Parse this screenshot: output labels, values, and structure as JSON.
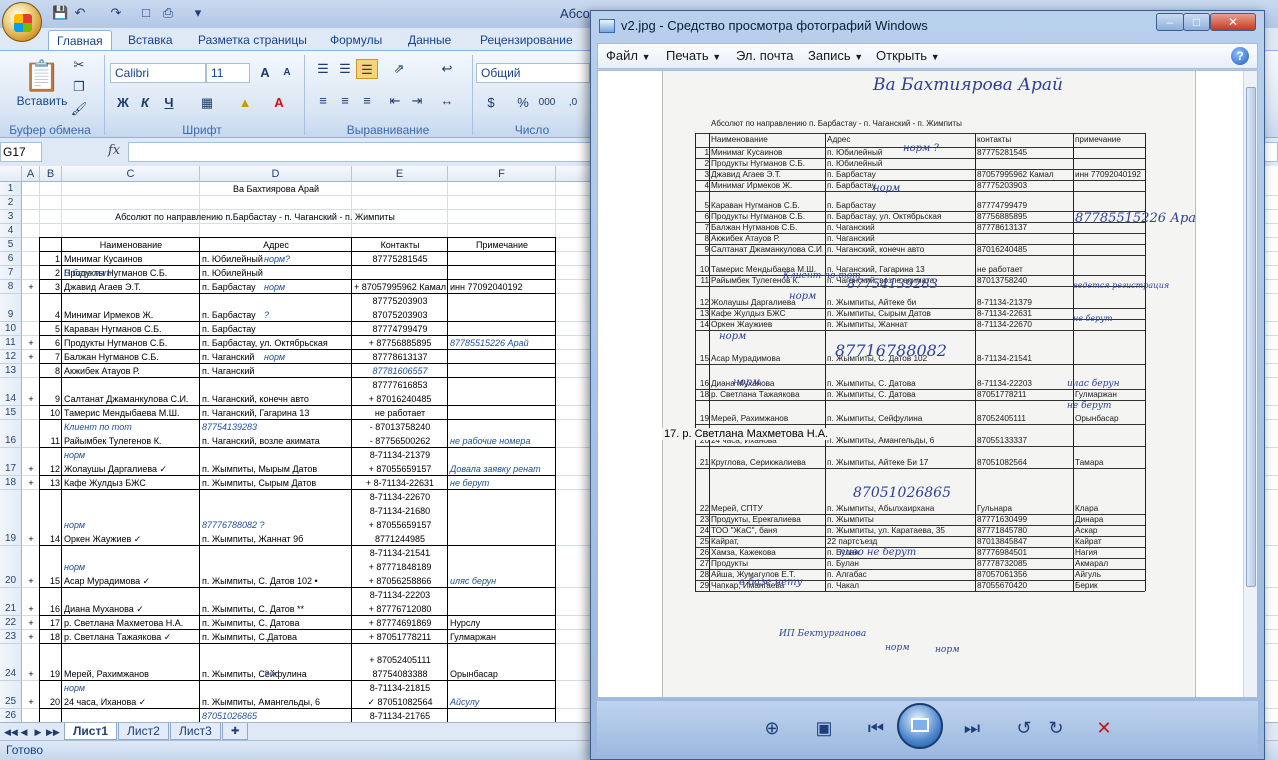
{
  "excel": {
    "title": "Абсолют по направлению...",
    "tabs": [
      "Главная",
      "Вставка",
      "Разметка страницы",
      "Формулы",
      "Данные",
      "Рецензирование"
    ],
    "ribbon": {
      "paste_label": "Вставить",
      "font_name": "Calibri",
      "font_size": "11",
      "number_format": "Общий",
      "groups": [
        "Буфер обмена",
        "Шрифт",
        "Выравнивание",
        "Число"
      ],
      "bold": "Ж",
      "italic": "К",
      "underline": "Ч"
    },
    "name_box": "G17",
    "fx": "fx",
    "columns": [
      "A",
      "B",
      "C",
      "D",
      "E",
      "F",
      "G"
    ],
    "title_row": "Ва     Бахтиярова Арай",
    "route_title": "Абсолют по направлению п.Барбастау - п. Чаганский - п. Жимпиты",
    "headers": {
      "name": "Наименование",
      "address": "Адрес",
      "contacts": "Контакты",
      "note": "Примечание"
    },
    "rows": [
      {
        "r": "6",
        "a": "",
        "b": "1",
        "c": "Минимаг Кусаинов",
        "d": "п. Юбилейный",
        "dn": "норм?",
        "e": "87775281545",
        "f": ""
      },
      {
        "r": "7",
        "a": "",
        "b": "2",
        "c": "Продукты Нугманов С.Б.",
        "d": "п. Юбилейный",
        "dn": "",
        "e": "",
        "f": ""
      },
      {
        "r": "8",
        "a": "+",
        "b": "3",
        "c": "Джавид Агаев Э.Т.",
        "cn": "В базе нет",
        "d": "п. Барбастау",
        "dn": "норм",
        "e": "+ 87057995962 Камал",
        "f": "инн 77092040192"
      },
      {
        "r": "9",
        "a": "",
        "b": "4",
        "c": "Минимаг Ирмеков Ж.",
        "d": "п. Барбастау",
        "dn": "?",
        "e": "87775203903\n87075203903",
        "f": ""
      },
      {
        "r": "10",
        "a": "",
        "b": "5",
        "c": "Караван Нугманов С.Б.",
        "d": "п. Барбастау",
        "dn": "",
        "e": "87774799479",
        "f": ""
      },
      {
        "r": "11",
        "a": "+",
        "b": "6",
        "c": "Продукты Нугманов С.Б.",
        "d": "п. Барбастау, ул. Октябрьская",
        "dn": "",
        "e": "+ 87756885895",
        "f": "87785515226 Арай",
        "fnote": true
      },
      {
        "r": "12",
        "a": "+",
        "b": "7",
        "c": "Балжан Нугманов С.Б.",
        "d": "п. Чаганский",
        "dn": "норм",
        "e": "87778613137",
        "f": ""
      },
      {
        "r": "13",
        "a": "",
        "b": "8",
        "c": "Акжибек Атауов Р.",
        "d": "п. Чаганский",
        "dn": "",
        "e": "87781606557",
        "enote": true,
        "f": ""
      },
      {
        "r": "14",
        "a": "+",
        "b": "9",
        "c": "Салтанат Джаманкулова С.И.",
        "d": "п. Чаганский, конечн авто",
        "dn": "",
        "e": "87777616853\n+ 87016240485",
        "f": ""
      },
      {
        "r": "15",
        "a": "",
        "b": "10",
        "c": "Тамерис Мендыбаева М.Ш.",
        "d": "п. Чаганский, Гагарина 13",
        "dn": "",
        "e": "не работает",
        "f": ""
      },
      {
        "r": "16",
        "a": "",
        "b": "11",
        "c": "Райымбек Тулегенов К.",
        "cn": "Клиент по тот",
        "d": "п. Чаганский, возле акимата",
        "dtop": "87754139283",
        "dn": "",
        "e": "- 87013758240\n- 87756500262",
        "f": "не рабочие номера",
        "fnote": true
      },
      {
        "r": "17",
        "a": "+",
        "b": "12",
        "c": "Жолаушы Даргалиева ✓",
        "cn": "норм",
        "d": "п. Жымпиты, Мырым Датов",
        "dn": "",
        "e": "8-71134-21379\n+ 87055659157",
        "f": "Довала заявку  ренат",
        "fnote": true
      },
      {
        "r": "18",
        "a": "+",
        "b": "13",
        "c": "Кафе Жулдыз БЖС",
        "d": "п. Жымпиты, Сырым Датов",
        "dn": "",
        "e": "+ 8-71134-22631",
        "f": "не берут",
        "fnote": true
      },
      {
        "r": "19",
        "a": "+",
        "b": "14",
        "c": "Оркен Жаужиев ✓",
        "cn": "норм",
        "d": "п. Жымпиты, Жаннат 9б",
        "dtop": "87776788082            ?",
        "dn": "",
        "e": "8-71134-22670\n8-71134-21680\n+ 87055659157\n8771244985",
        "f": ""
      },
      {
        "r": "20",
        "a": "+",
        "b": "15",
        "c": "Асар Мурадимова ✓",
        "cn": "норм",
        "d": "п. Жымпиты, С. Датов 102 •",
        "dn": "",
        "e": "8-71134-21541\n+ 87771848189\n+ 87056258866",
        "f": "иляс берун",
        "fnote": true
      },
      {
        "r": "21",
        "a": "+",
        "b": "16",
        "c": "Диана Муханова ✓",
        "d": "п. Жымпиты, С. Датов **",
        "dn": "",
        "e": "8-71134-22203\n+ 87776712080",
        "f": ""
      },
      {
        "r": "22",
        "a": "+",
        "b": "17",
        "c": "р. Светлана Махметова Н.А.",
        "d": "п. Жымпиты, С. Датова",
        "dn": "",
        "e": "+ 87774691869",
        "f": "Нурслу"
      },
      {
        "r": "23",
        "a": "+",
        "b": "18",
        "c": "р. Светлана Тажаякова ✓",
        "d": "п. Жымпиты, С.Датова",
        "dn": "",
        "e": "+ 87051778211",
        "f": "Гулмаржан"
      },
      {
        "r": "24",
        "a": "+",
        "b": "19",
        "c": "Мерей, Рахимжанов",
        "d": "п. Жымпиты, Сейфулина",
        "dn": "? ×",
        "e": "+ 87052405111\n87754083388",
        "f": "Орынбасар"
      },
      {
        "r": "25",
        "a": "+",
        "b": "20",
        "c": "24 часа, Иханова ✓",
        "cn": "норм",
        "d": "п. Жымпиты, Амангельды, 6",
        "dn": "",
        "e": "8-71134-21815\n✓ 87051082564",
        "f": "Айсулу",
        "fnote": true
      }
    ],
    "row_partial": {
      "d": "87051026865",
      "e": "8-71134-21765"
    },
    "sheets": [
      "Лист1",
      "Лист2",
      "Лист3"
    ],
    "status": "Готово"
  },
  "viewer": {
    "title": "v2.jpg - Средство просмотра фотографий Windows",
    "menu": [
      "Файл",
      "Печать",
      "Эл. почта",
      "Запись",
      "Открыть"
    ],
    "tooltip": "17. р. Светлана Махметова Н.А.",
    "paper": {
      "hand_title": "Ва   Бахтиярова Арай",
      "route": "Абсолют по направлению  п. Барбастау - п. Чаганский - п. Жимпиты",
      "headers": [
        "Наименование",
        "Адрес",
        "контакты",
        "примечание"
      ],
      "rows": [
        {
          "n": "1",
          "name": "Минимаг Кусаинов",
          "addr": "п. Юбилейный",
          "cont": "87775281545",
          "note": ""
        },
        {
          "n": "2",
          "name": "Продукты Нугманов С.Б.",
          "addr": "п. Юбилейный",
          "cont": "",
          "note": ""
        },
        {
          "n": "3",
          "name": "Джавид Агаев Э.Т.",
          "addr": "п. Барбастау",
          "cont": "87057995962 Камал",
          "note": "инн 77092040192"
        },
        {
          "n": "4",
          "name": "Минимаг Ирмеков Ж.",
          "addr": "п. Барбастау",
          "cont": "87775203903",
          "note": ""
        },
        {
          "n": "5",
          "name": "Караван Нугманов С.Б.",
          "addr": "п. Барбастау",
          "cont": "87774799479",
          "note": ""
        },
        {
          "n": "6",
          "name": "Продукты Нугманов С.Б.",
          "addr": "п. Барбастау, ул. Октябрьская",
          "cont": "87756885895",
          "note": ""
        },
        {
          "n": "7",
          "name": "Балжан Нугманов С.Б.",
          "addr": "п. Чаганский",
          "cont": "87778613137",
          "note": ""
        },
        {
          "n": "8",
          "name": "Акжибек Атауов Р.",
          "addr": "п. Чаганский",
          "cont": "",
          "note": ""
        },
        {
          "n": "9",
          "name": "Салтанат Джаманкулова С.И.",
          "addr": "п. Чаганский, конечн авто",
          "cont": "87016240485",
          "note": ""
        },
        {
          "n": "10",
          "name": "Тамерис Мендыбаева М.Ш.",
          "addr": "п. Чаганский, Гагарина 13",
          "cont": "не работает",
          "note": ""
        },
        {
          "n": "11",
          "name": "Райымбек Тулегенов К.",
          "addr": "п. Чаганский, возле акимата",
          "cont": "87013758240",
          "note": ""
        },
        {
          "n": "12",
          "name": "Жолаушы Даргалиева",
          "addr": "п. Жымпиты, Айтеке би",
          "cont": "8-71134-21379",
          "note": ""
        },
        {
          "n": "13",
          "name": "Кафе Жулдыз БЖС",
          "addr": "п. Жымпиты, Сырым Датов",
          "cont": "8-71134-22631",
          "note": ""
        },
        {
          "n": "14",
          "name": "Оркен Жаужиев",
          "addr": "п. Жымпиты, Жаннат",
          "cont": "8-71134-22670",
          "note": ""
        },
        {
          "n": "15",
          "name": "Асар Мурадимова",
          "addr": "п. Жымпиты, С. Датов 102",
          "cont": "8-71134-21541",
          "note": ""
        },
        {
          "n": "16",
          "name": "Диана Муханова",
          "addr": "п. Жымпиты, С. Датова",
          "cont": "8-71134-22203",
          "note": ""
        },
        {
          "n": "18",
          "name": "р. Светлана Тажаякова",
          "addr": "п. Жымпиты, С. Датова",
          "cont": "87051778211",
          "note": "Гулмаржан"
        },
        {
          "n": "19",
          "name": "Мерей, Рахимжанов",
          "addr": "п. Жымпиты, Сейфулина",
          "cont": "87052405111",
          "note": "Орынбасар"
        },
        {
          "n": "20",
          "name": "24 часа, Иханова",
          "addr": "п. Жымпиты, Амангельды, 6",
          "cont": "87055133337",
          "note": ""
        },
        {
          "n": "21",
          "name": "Круглова, Серикжалиева",
          "addr": "п. Жымпиты, Айтеке Би 17",
          "cont": "87051082564",
          "note": "Тамара"
        },
        {
          "n": "22",
          "name": "Мерей, СПТУ",
          "addr": "п. Жымпиты, Абылхаирхана",
          "cont": "Гульнара",
          "note": "Клара"
        },
        {
          "n": "23",
          "name": "Продукты, Ерекгалиева",
          "addr": "п. Жымпиты",
          "cont": "87771630499",
          "note": "Динара"
        },
        {
          "n": "24",
          "name": "ТОО \"ЖаС\", баня",
          "addr": "п. Жымпиты, ул. Каратаева, 35",
          "cont": "87771845780",
          "note": "Аскар"
        },
        {
          "n": "25",
          "name": "Кайрат,",
          "addr": "22 партсъезд",
          "cont": "87013845847",
          "note": "Кайрат"
        },
        {
          "n": "26",
          "name": "Хамза, Кажекова",
          "addr": "п. Булан",
          "cont": "87776984501",
          "note": "Нагия"
        },
        {
          "n": "27",
          "name": "Продукты",
          "addr": "п. Булан",
          "cont": "87778732085",
          "note": "Акмарал"
        },
        {
          "n": "28",
          "name": "Айша, Жумагулов Е.Т.",
          "addr": "п. Алгабас",
          "cont": "87057061356",
          "note": "Айгуль"
        },
        {
          "n": "29",
          "name": "Чапкар, Имангаева",
          "addr": "п. Чакал",
          "cont": "87055670420",
          "note": "Берик"
        }
      ],
      "hand_notes": [
        "норм ?",
        "норм",
        "87785515226 Арай",
        "Клиент по тот",
        "87754139283",
        "норм",
        "ведется регистрация",
        "не берут",
        "норм",
        "87716788082",
        "норм",
        "илас берун",
        "не берут",
        "87051026865",
        "пиво не берут",
        "в базе нету",
        "ИП Бектурганова",
        "норм",
        "норм"
      ]
    }
  }
}
